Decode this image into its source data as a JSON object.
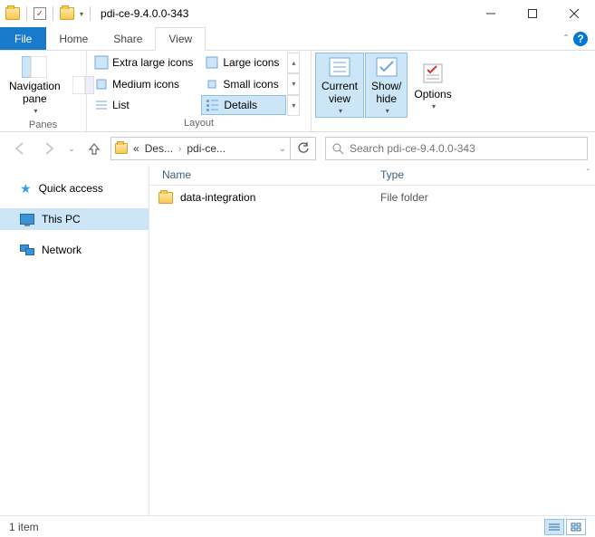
{
  "window": {
    "title": "pdi-ce-9.4.0.0-343"
  },
  "menu": {
    "file": "File",
    "home": "Home",
    "share": "Share",
    "view": "View"
  },
  "ribbon": {
    "nav_pane": "Navigation\npane",
    "panes_group": "Panes",
    "layout": {
      "xl": "Extra large icons",
      "lg": "Large icons",
      "md": "Medium icons",
      "sm": "Small icons",
      "list": "List",
      "details": "Details",
      "group": "Layout"
    },
    "current_view": "Current\nview",
    "show_hide": "Show/\nhide",
    "options": "Options"
  },
  "breadcrumb": {
    "trunc": "«",
    "p1": "Des...",
    "p2": "pdi-ce..."
  },
  "search": {
    "placeholder": "Search pdi-ce-9.4.0.0-343"
  },
  "sidebar": {
    "quick": "Quick access",
    "thispc": "This PC",
    "network": "Network"
  },
  "columns": {
    "name": "Name",
    "type": "Type"
  },
  "items": [
    {
      "name": "data-integration",
      "type": "File folder"
    }
  ],
  "status": {
    "count": "1 item"
  }
}
